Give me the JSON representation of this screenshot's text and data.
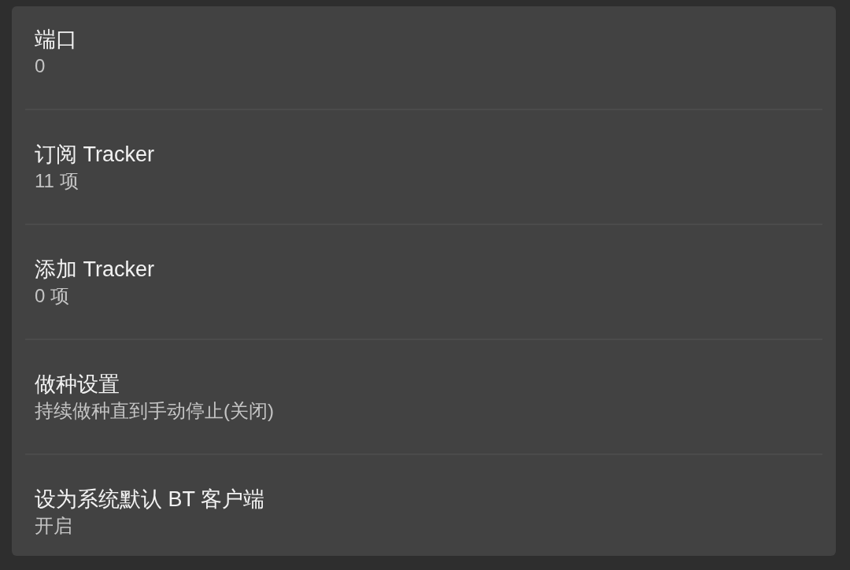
{
  "settings": [
    {
      "label": "端口",
      "value": "0"
    },
    {
      "label": "订阅 Tracker",
      "value": "11 项"
    },
    {
      "label": "添加 Tracker",
      "value": "0 项"
    },
    {
      "label": "做种设置",
      "value": "持续做种直到手动停止(关闭)"
    },
    {
      "label": "设为系统默认 BT 客户端",
      "value": "开启"
    }
  ]
}
